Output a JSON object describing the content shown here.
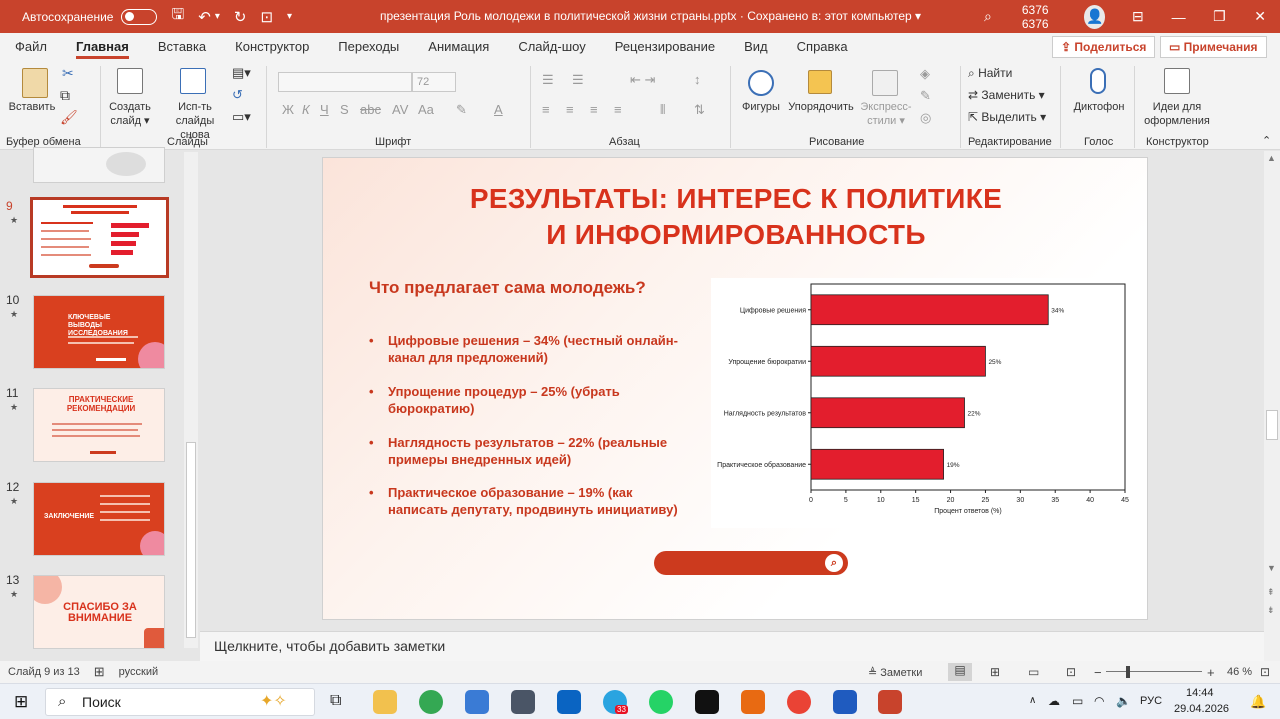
{
  "titlebar": {
    "autosave_label": "Автосохранение",
    "doc_title": "презентация Роль молодежи в политической жизни страны.pptx  ·  Сохранено в: этот компьютер  ▾",
    "user": "6376 6376"
  },
  "menu": {
    "items": [
      "Файл",
      "Главная",
      "Вставка",
      "Конструктор",
      "Переходы",
      "Анимация",
      "Слайд-шоу",
      "Рецензирование",
      "Вид",
      "Справка"
    ],
    "active": "Главная",
    "share": "Поделиться",
    "comments": "Примечания"
  },
  "ribbon": {
    "paste": "Вставить",
    "new_slide": "Создать слайд ▾",
    "reuse_slides": "Исп-ть слайды снова",
    "font_size": "72",
    "shapes": "Фигуры",
    "arrange": "Упорядочить",
    "quick_styles": "Экспресс-стили ▾",
    "find": "Найти",
    "replace": "Заменить",
    "select": "Выделить",
    "dictate": "Диктофон",
    "designer": "Идеи для оформления",
    "groups": {
      "clipboard": "Буфер обмена",
      "slides": "Слайды",
      "font": "Шрифт",
      "paragraph": "Абзац",
      "drawing": "Рисование",
      "editing": "Редактирование",
      "voice": "Голос",
      "designer": "Конструктор"
    }
  },
  "thumbnails": {
    "numbers": [
      "9",
      "10",
      "11",
      "12",
      "13"
    ],
    "t10": "КЛЮЧЕВЫЕ ВЫВОДЫ ИССЛЕДОВАНИЯ",
    "t11": "ПРАКТИЧЕСКИЕ РЕКОМЕНДАЦИИ",
    "t12": "ЗАКЛЮЧЕНИЕ",
    "t13": "СПАСИБО ЗА ВНИМАНИЕ"
  },
  "slide": {
    "title_line1": "РЕЗУЛЬТАТЫ: ИНТЕРЕС К ПОЛИТИКЕ",
    "title_line2": "И ИНФОРМИРОВАННОСТЬ",
    "subtitle": "Что предлагает сама молодежь?",
    "bullets": [
      "Цифровые решения – 34% (честный онлайн-канал для предложений)",
      "Упрощение процедур – 25% (убрать бюрократию)",
      "Наглядность результатов – 22% (реальные примеры внедренных идей)",
      "Практическое образование – 19% (как написать депутату, продвинуть инициативу)"
    ]
  },
  "chart_data": {
    "type": "bar",
    "orientation": "horizontal",
    "categories": [
      "Цифровые решения",
      "Упрощение бюрократии",
      "Наглядность результатов",
      "Практическое образование"
    ],
    "values": [
      34,
      25,
      22,
      19
    ],
    "value_labels": [
      "34%",
      "25%",
      "22%",
      "19%"
    ],
    "xlabel": "Процент ответов (%)",
    "xlim": [
      0,
      45
    ],
    "xticks": [
      0,
      5,
      10,
      15,
      20,
      25,
      30,
      35,
      40,
      45
    ],
    "bar_color": "#e31e2d"
  },
  "notes_placeholder": "Щелкните, чтобы добавить заметки",
  "status": {
    "slide_counter": "Слайд 9 из 13",
    "language": "русский",
    "notes_btn": "Заметки",
    "zoom": "46 %"
  },
  "taskbar": {
    "search": "Поиск",
    "lang": "РУС",
    "time": "14:44",
    "date": "29.04.2026",
    "badge": "33"
  },
  "colors": {
    "accent": "#c8432c",
    "slide_red": "#d8321c"
  }
}
